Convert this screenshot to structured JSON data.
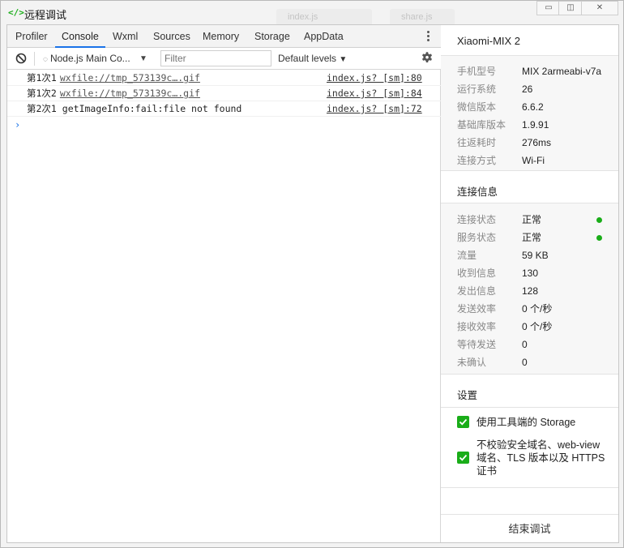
{
  "window": {
    "title": "远程调试",
    "title_icon": "code-icon"
  },
  "background_tabs": [
    "index.js",
    "share.js"
  ],
  "devtools": {
    "tabs": [
      "Profiler",
      "Console",
      "Wxml",
      "Sources",
      "Memory",
      "Storage",
      "AppData"
    ],
    "active_tab": "Console",
    "toolbar": {
      "context": "Node.js Main Co...",
      "filter_placeholder": "Filter",
      "levels": "Default levels"
    },
    "console_rows": [
      {
        "prefix": "第1次1",
        "link": "wxfile://tmp_573139c….gif",
        "source": "index.js? [sm]:80"
      },
      {
        "prefix": "第1次2",
        "link": "wxfile://tmp_573139c….gif",
        "source": "index.js? [sm]:84"
      },
      {
        "prefix": "第2次1",
        "text": "getImageInfo:fail:file not found",
        "source": "index.js? [sm]:72"
      }
    ],
    "prompt": "›"
  },
  "device": {
    "name": "Xiaomi-MIX 2",
    "info": [
      {
        "label": "手机型号",
        "value": "MIX 2armeabi-v7a"
      },
      {
        "label": "运行系统",
        "value": "26"
      },
      {
        "label": "微信版本",
        "value": "6.6.2"
      },
      {
        "label": "基础库版本",
        "value": "1.9.91"
      },
      {
        "label": "往返耗时",
        "value": "276ms"
      },
      {
        "label": "连接方式",
        "value": "Wi-Fi"
      }
    ]
  },
  "connection": {
    "title": "连接信息",
    "items": [
      {
        "label": "连接状态",
        "value": "正常"
      },
      {
        "label": "服务状态",
        "value": "正常"
      },
      {
        "label": "流量",
        "value": "59 KB"
      },
      {
        "label": "收到信息",
        "value": "130"
      },
      {
        "label": "发出信息",
        "value": "128"
      },
      {
        "label": "发送效率",
        "value": "0 个/秒"
      },
      {
        "label": "接收效率",
        "value": "0 个/秒"
      },
      {
        "label": "等待发送",
        "value": "0"
      },
      {
        "label": "未确认",
        "value": "0"
      }
    ],
    "status_color": "#1aad19"
  },
  "settings": {
    "title": "设置",
    "options": [
      {
        "label": "使用工具端的 Storage",
        "checked": true
      },
      {
        "label": "不校验安全域名、web-view 域名、TLS 版本以及 HTTPS 证书",
        "checked": true
      }
    ]
  },
  "end_button": "结束调试",
  "colors": {
    "accent": "#1a73e8",
    "green": "#1aad19"
  }
}
